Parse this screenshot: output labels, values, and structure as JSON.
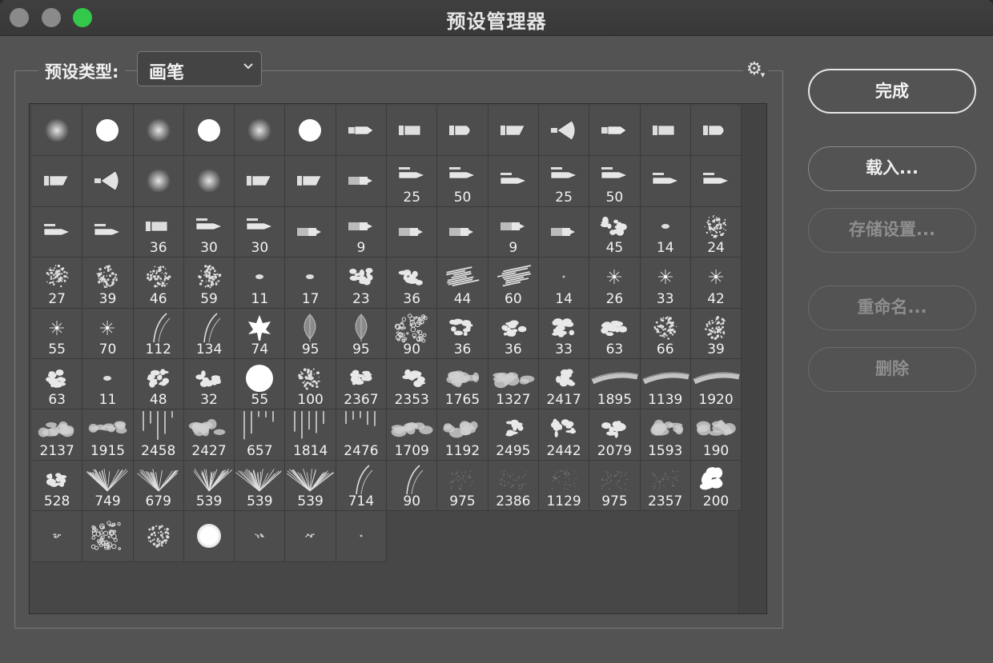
{
  "window": {
    "title": "预设管理器"
  },
  "preset_type": {
    "label": "预设类型:",
    "selected": "画笔"
  },
  "buttons": {
    "done": "完成",
    "load": "载入...",
    "save": "存储设置...",
    "rename": "重命名...",
    "delete": "删除"
  },
  "icons": {
    "menu": "gear-icon",
    "dropdown": "chevron-down-icon"
  },
  "brushes": [
    {
      "shape": "soft",
      "size": ""
    },
    {
      "shape": "hard",
      "size": ""
    },
    {
      "shape": "soft",
      "size": ""
    },
    {
      "shape": "hard",
      "size": ""
    },
    {
      "shape": "soft",
      "size": ""
    },
    {
      "shape": "hard",
      "size": ""
    },
    {
      "shape": "tool-pencil",
      "size": ""
    },
    {
      "shape": "tool-flat",
      "size": ""
    },
    {
      "shape": "tool-round",
      "size": ""
    },
    {
      "shape": "tool-angle",
      "size": ""
    },
    {
      "shape": "tool-fan",
      "size": ""
    },
    {
      "shape": "tool-pencil",
      "size": ""
    },
    {
      "shape": "tool-flat",
      "size": ""
    },
    {
      "shape": "tool-round",
      "size": ""
    },
    {
      "shape": "tool-angle",
      "size": ""
    },
    {
      "shape": "tool-fan",
      "size": ""
    },
    {
      "shape": "soft",
      "size": ""
    },
    {
      "shape": "soft",
      "size": ""
    },
    {
      "shape": "tool-angle",
      "size": ""
    },
    {
      "shape": "tool-angle",
      "size": ""
    },
    {
      "shape": "tool-marker",
      "size": ""
    },
    {
      "shape": "tool-pen",
      "size": "25"
    },
    {
      "shape": "tool-pen",
      "size": "50"
    },
    {
      "shape": "tool-pen",
      "size": ""
    },
    {
      "shape": "tool-pen",
      "size": "25"
    },
    {
      "shape": "tool-pen",
      "size": "50"
    },
    {
      "shape": "tool-pen",
      "size": ""
    },
    {
      "shape": "tool-pen",
      "size": ""
    },
    {
      "shape": "tool-pen",
      "size": ""
    },
    {
      "shape": "tool-pen",
      "size": ""
    },
    {
      "shape": "tool-flat",
      "size": "36"
    },
    {
      "shape": "tool-pen",
      "size": "30"
    },
    {
      "shape": "tool-pen",
      "size": "30"
    },
    {
      "shape": "tool-marker",
      "size": ""
    },
    {
      "shape": "tool-marker",
      "size": "9"
    },
    {
      "shape": "tool-marker",
      "size": ""
    },
    {
      "shape": "tool-marker",
      "size": ""
    },
    {
      "shape": "tool-marker",
      "size": "9"
    },
    {
      "shape": "tool-marker",
      "size": ""
    },
    {
      "shape": "splatter",
      "size": "45"
    },
    {
      "shape": "dot-small",
      "size": "14"
    },
    {
      "shape": "speckle",
      "size": "24"
    },
    {
      "shape": "speckle",
      "size": "27"
    },
    {
      "shape": "speckle",
      "size": "39"
    },
    {
      "shape": "speckle",
      "size": "46"
    },
    {
      "shape": "speckle",
      "size": "59"
    },
    {
      "shape": "dot-small",
      "size": "11"
    },
    {
      "shape": "dot-small",
      "size": "17"
    },
    {
      "shape": "splatter",
      "size": "23"
    },
    {
      "shape": "splatter",
      "size": "36"
    },
    {
      "shape": "chalk",
      "size": "44"
    },
    {
      "shape": "chalk",
      "size": "60"
    },
    {
      "shape": "dot-tiny",
      "size": "14"
    },
    {
      "shape": "star",
      "size": "26"
    },
    {
      "shape": "star",
      "size": "33"
    },
    {
      "shape": "star",
      "size": "42"
    },
    {
      "shape": "star",
      "size": "55"
    },
    {
      "shape": "star",
      "size": "70"
    },
    {
      "shape": "grass-blade",
      "size": "112"
    },
    {
      "shape": "grass-blade",
      "size": "134"
    },
    {
      "shape": "maple-leaf",
      "size": "74"
    },
    {
      "shape": "leaf",
      "size": "95"
    },
    {
      "shape": "leaf",
      "size": "95"
    },
    {
      "shape": "sponge",
      "size": "90"
    },
    {
      "shape": "splatter",
      "size": "36"
    },
    {
      "shape": "splatter",
      "size": "36"
    },
    {
      "shape": "splatter",
      "size": "33"
    },
    {
      "shape": "splatter",
      "size": "63"
    },
    {
      "shape": "speckle",
      "size": "66"
    },
    {
      "shape": "speckle",
      "size": "39"
    },
    {
      "shape": "splatter",
      "size": "63"
    },
    {
      "shape": "dot-small",
      "size": "11"
    },
    {
      "shape": "splatter",
      "size": "48"
    },
    {
      "shape": "splatter",
      "size": "32"
    },
    {
      "shape": "hard",
      "size": "55"
    },
    {
      "shape": "speckle",
      "size": "100"
    },
    {
      "shape": "splatter",
      "size": "2367"
    },
    {
      "shape": "splatter",
      "size": "2353"
    },
    {
      "shape": "cloud",
      "size": "1765"
    },
    {
      "shape": "cloud",
      "size": "1327"
    },
    {
      "shape": "splatter",
      "size": "2417"
    },
    {
      "shape": "stroke",
      "size": "1895"
    },
    {
      "shape": "stroke",
      "size": "1139"
    },
    {
      "shape": "stroke",
      "size": "1920"
    },
    {
      "shape": "cloud",
      "size": "2137"
    },
    {
      "shape": "cloud",
      "size": "1915"
    },
    {
      "shape": "drip",
      "size": "2458"
    },
    {
      "shape": "cloud",
      "size": "2427"
    },
    {
      "shape": "drip",
      "size": "657"
    },
    {
      "shape": "drip",
      "size": "1814"
    },
    {
      "shape": "drip",
      "size": "2476"
    },
    {
      "shape": "cloud",
      "size": "1709"
    },
    {
      "shape": "cloud",
      "size": "1192"
    },
    {
      "shape": "splatter",
      "size": "2495"
    },
    {
      "shape": "splatter",
      "size": "2442"
    },
    {
      "shape": "splatter",
      "size": "2079"
    },
    {
      "shape": "cloud",
      "size": "1593"
    },
    {
      "shape": "cloud",
      "size": "190"
    },
    {
      "shape": "splatter",
      "size": "528"
    },
    {
      "shape": "grass",
      "size": "749"
    },
    {
      "shape": "grass",
      "size": "679"
    },
    {
      "shape": "grass",
      "size": "539"
    },
    {
      "shape": "grass",
      "size": "539"
    },
    {
      "shape": "grass",
      "size": "539"
    },
    {
      "shape": "grass-blade",
      "size": "714"
    },
    {
      "shape": "grass-blade",
      "size": "90"
    },
    {
      "shape": "faint",
      "size": "975"
    },
    {
      "shape": "faint",
      "size": "2386"
    },
    {
      "shape": "faint",
      "size": "1129"
    },
    {
      "shape": "faint",
      "size": "975"
    },
    {
      "shape": "faint",
      "size": "2357"
    },
    {
      "shape": "blob",
      "size": "200"
    },
    {
      "shape": "small-texture",
      "size": ""
    },
    {
      "shape": "sponge",
      "size": ""
    },
    {
      "shape": "speckle",
      "size": ""
    },
    {
      "shape": "hard-soft",
      "size": ""
    },
    {
      "shape": "small-texture",
      "size": ""
    },
    {
      "shape": "small-texture",
      "size": ""
    },
    {
      "shape": "dot-tiny",
      "size": ""
    }
  ]
}
